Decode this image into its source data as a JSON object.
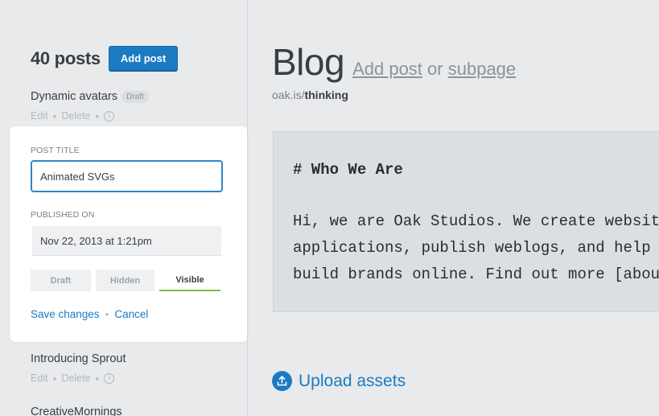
{
  "sidebar": {
    "posts_count": "40 posts",
    "add_post_button": "Add post",
    "posts": [
      {
        "title": "Dynamic avatars",
        "badge": "Draft",
        "edit": "Edit",
        "delete": "Delete"
      },
      {
        "title": "Introducing Sprout",
        "edit": "Edit",
        "delete": "Delete"
      },
      {
        "title": "CreativeMornings"
      }
    ]
  },
  "edit_form": {
    "title_label": "POST TITLE",
    "title_value": "Animated SVGs",
    "published_label": "PUBLISHED ON",
    "published_value": "Nov 22, 2013 at 1:21pm",
    "visibility_options": [
      "Draft",
      "Hidden",
      "Visible"
    ],
    "visibility_selected": "Visible",
    "save_label": "Save changes",
    "cancel_label": "Cancel"
  },
  "main": {
    "title": "Blog",
    "add_post_link": "Add post",
    "or_text": "or",
    "subpage_link": "subpage",
    "url_prefix": "oak.is/",
    "url_slug": "thinking",
    "editor": {
      "heading": "# Who We Are",
      "lines": [
        "Hi, we are Oak Studios. We create websites and",
        "applications, publish weblogs, and help people",
        "build brands online. Find out more [about us]"
      ]
    },
    "upload_label": "Upload assets"
  },
  "colors": {
    "accent": "#1a7bc2",
    "visible_underline": "#7ac142",
    "background": "#e8eaec"
  }
}
